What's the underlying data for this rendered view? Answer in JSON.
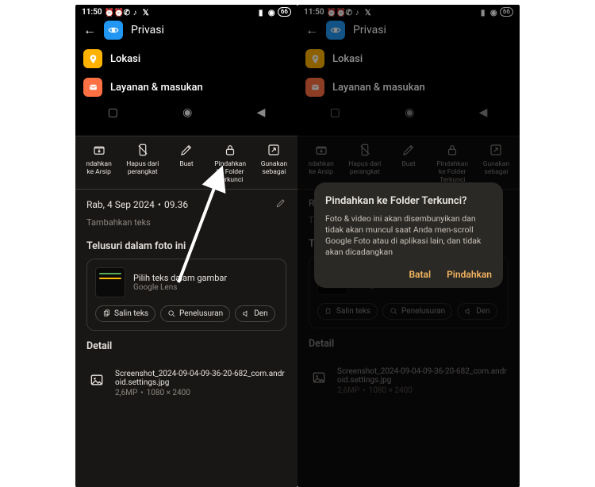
{
  "statusbar": {
    "time": "11:50",
    "battery": "66"
  },
  "app_header": {
    "title": "Privasi"
  },
  "settings": {
    "lokasi": "Lokasi",
    "layanan": "Layanan & masukan"
  },
  "actions": {
    "arsip": "ndahkan\nke Arsip",
    "arsip_full": "Pindahkan ke Arsip",
    "hapus": "Hapus dari\nperangkat",
    "buat": "Buat",
    "pindahkan_folder": "Pindahkan\nke Folder\nTerkunci",
    "gunakan": "Gunakan\nsebagai"
  },
  "meta": {
    "date": "Rab, 4 Sep 2024",
    "sep": "•",
    "time": "09.36",
    "addtext": "Tambahkan teks",
    "addtext_trunc": "Ta"
  },
  "lens": {
    "section": "Telusuri dalam foto ini",
    "title": "Pilih teks dalam gambar",
    "sub": "Google Lens",
    "chip1": "Salin teks",
    "chip2": "Penelusuran",
    "chip3": "Den",
    "chip3_full": "Dengar"
  },
  "detail": {
    "section": "Detail",
    "filename": "Screenshot_2024-09-04-09-36-20-682_com.android.settings.jpg",
    "mp": "2,6MP",
    "sep": "•",
    "dims": "1080 × 2400"
  },
  "dialog": {
    "title": "Pindahkan ke Folder Terkunci?",
    "body": "Foto & video ini akan disembunyikan dan tidak akan muncul saat Anda men-scroll Google Foto atau di aplikasi lain, dan tidak akan dicadangkan",
    "cancel": "Batal",
    "confirm": "Pindahkan"
  }
}
